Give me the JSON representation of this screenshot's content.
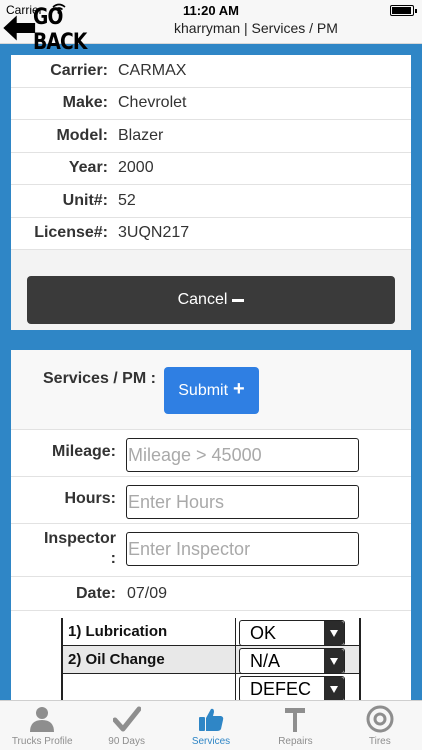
{
  "status_bar": {
    "carrier": "Carrier",
    "time": "11:20 AM"
  },
  "nav": {
    "back_label": "GO BACK",
    "title": "kharryman | Services / PM"
  },
  "truck_info": {
    "rows": [
      {
        "label": "Carrier:",
        "value": "CARMAX"
      },
      {
        "label": "Make:",
        "value": "Chevrolet"
      },
      {
        "label": "Model:",
        "value": "Blazer"
      },
      {
        "label": "Year:",
        "value": "2000"
      },
      {
        "label": "Unit#:",
        "value": "52"
      },
      {
        "label": "License#:",
        "value": "3UQN217"
      }
    ],
    "cancel_label": "Cancel"
  },
  "services": {
    "label": "Services / PM :",
    "submit_label": "Submit",
    "mileage": {
      "label": "Mileage:",
      "placeholder": "Mileage > 45000",
      "value": ""
    },
    "hours": {
      "label": "Hours:",
      "placeholder": "Enter Hours",
      "value": ""
    },
    "inspector": {
      "label_line1": "Inspector",
      "label_line2": ":",
      "placeholder": "Enter Inspector",
      "value": ""
    },
    "date": {
      "label": "Date:",
      "value": "07/09"
    }
  },
  "checklist": [
    {
      "item": "1) Lubrication",
      "status": "OK"
    },
    {
      "item": "2) Oil Change",
      "status": "N/A"
    },
    {
      "item": "",
      "status": "DEFEC"
    }
  ],
  "tabs": [
    {
      "label": "Trucks Profile",
      "icon": "person-icon",
      "active": false
    },
    {
      "label": "90 Days",
      "icon": "checkmark-icon",
      "active": false
    },
    {
      "label": "Services",
      "icon": "thumbs-up-icon",
      "active": true
    },
    {
      "label": "Repairs",
      "icon": "hammer-icon",
      "active": false
    },
    {
      "label": "Tires",
      "icon": "tire-icon",
      "active": false
    }
  ],
  "colors": {
    "background": "#2f86c6",
    "submit": "#2f7fe3",
    "cancel": "#3a3a3a",
    "active_tab": "#2f86c6"
  }
}
